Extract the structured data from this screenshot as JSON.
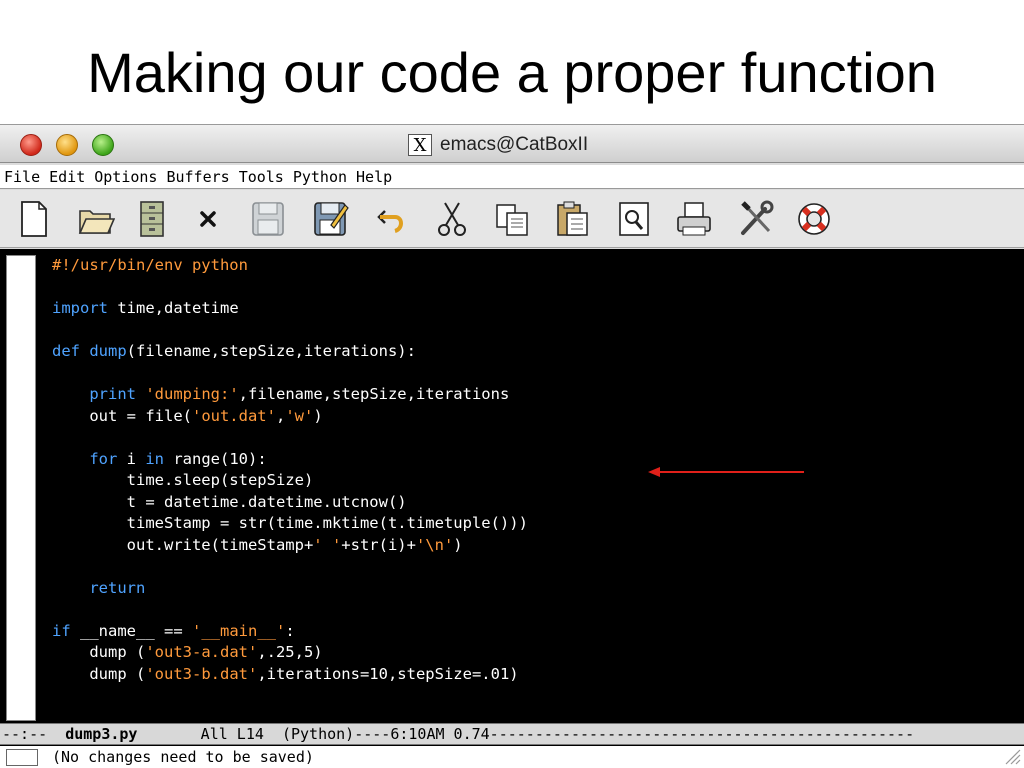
{
  "slide": {
    "title": "Making our code a proper function"
  },
  "window": {
    "title": "emacs@CatBoxII",
    "x_logo": "X"
  },
  "menubar": {
    "items": [
      "File",
      "Edit",
      "Options",
      "Buffers",
      "Tools",
      "Python",
      "Help"
    ]
  },
  "toolbar": {
    "icons": [
      "new-file-icon",
      "open-folder-icon",
      "file-cabinet-icon",
      "close-icon",
      "save-disabled-icon",
      "save-as-icon",
      "undo-icon",
      "cut-icon",
      "copy-icon",
      "paste-icon",
      "search-icon",
      "print-icon",
      "tools-icon",
      "help-lifebuoy-icon"
    ]
  },
  "code": {
    "lines": [
      [
        {
          "t": "#!/usr/bin/env python",
          "c": "cmt"
        }
      ],
      [],
      [
        {
          "t": "import",
          "c": "kw"
        },
        {
          "t": " time,datetime",
          "c": ""
        }
      ],
      [],
      [
        {
          "t": "def",
          "c": "kw"
        },
        {
          "t": " ",
          "c": ""
        },
        {
          "t": "dump",
          "c": "fn"
        },
        {
          "t": "(filename,stepSize,iterations):",
          "c": ""
        }
      ],
      [],
      [
        {
          "t": "    ",
          "c": ""
        },
        {
          "t": "print",
          "c": "kw"
        },
        {
          "t": " ",
          "c": ""
        },
        {
          "t": "'dumping:'",
          "c": "str"
        },
        {
          "t": ",filename,stepSize,iterations",
          "c": ""
        }
      ],
      [
        {
          "t": "    out = file(",
          "c": ""
        },
        {
          "t": "'out.dat'",
          "c": "str"
        },
        {
          "t": ",",
          "c": ""
        },
        {
          "t": "'w'",
          "c": "str"
        },
        {
          "t": ")",
          "c": ""
        }
      ],
      [],
      [
        {
          "t": "    ",
          "c": ""
        },
        {
          "t": "for",
          "c": "kw"
        },
        {
          "t": " i ",
          "c": ""
        },
        {
          "t": "in",
          "c": "kw"
        },
        {
          "t": " range(10):",
          "c": ""
        }
      ],
      [
        {
          "t": "        time.sleep(stepSize)",
          "c": ""
        }
      ],
      [
        {
          "t": "        t = datetime.datetime.utcnow()",
          "c": ""
        }
      ],
      [
        {
          "t": "        timeStamp = str(time.mktime(t.timetuple()))",
          "c": ""
        }
      ],
      [
        {
          "t": "        out.write(timeStamp+",
          "c": ""
        },
        {
          "t": "' '",
          "c": "str"
        },
        {
          "t": "+str(i)+",
          "c": ""
        },
        {
          "t": "'\\n'",
          "c": "str"
        },
        {
          "t": ")",
          "c": ""
        }
      ],
      [],
      [
        {
          "t": "    ",
          "c": ""
        },
        {
          "t": "return",
          "c": "kw"
        }
      ],
      [],
      [
        {
          "t": "if",
          "c": "kw"
        },
        {
          "t": " __name__ == ",
          "c": ""
        },
        {
          "t": "'__main__'",
          "c": "str"
        },
        {
          "t": ":",
          "c": ""
        }
      ],
      [
        {
          "t": "    dump (",
          "c": ""
        },
        {
          "t": "'out3-a.dat'",
          "c": "str"
        },
        {
          "t": ",.25,5)",
          "c": ""
        }
      ],
      [
        {
          "t": "    dump (",
          "c": ""
        },
        {
          "t": "'out3-b.dat'",
          "c": "str"
        },
        {
          "t": ",iterations=10,stepSize=.01)",
          "c": ""
        }
      ]
    ]
  },
  "modeline": {
    "prefix": "--:--  ",
    "buffer": "dump3.py",
    "rest": "       All L14  (Python)----6:10AM 0.74-----------------------------------------------"
  },
  "minibuffer": {
    "message": "(No changes need to be saved)"
  },
  "colors": {
    "keyword": "#4fa3ff",
    "string": "#ff9a3c",
    "arrow": "#e0201a"
  }
}
